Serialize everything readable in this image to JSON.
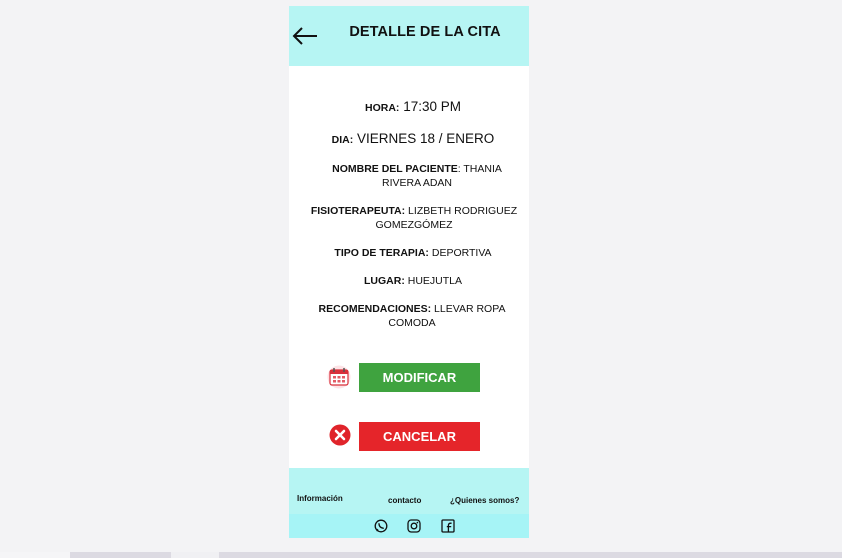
{
  "header": {
    "title": "DETALLE DE LA CITA",
    "back_icon": "arrow-left-icon",
    "background": "#b6f5f3"
  },
  "details": {
    "hora": {
      "label": "HORA:",
      "value": " 17:30 PM"
    },
    "dia": {
      "label": "DIA:",
      "value": " VIERNES 18 / ENERO"
    },
    "paciente": {
      "label": "NOMBRE DEL PACIENTE",
      "value": ": THANIA RIVERA ADAN"
    },
    "fisioterapeuta": {
      "label": "FISIOTERAPEUTA:",
      "value": " LIZBETH RODRIGUEZ GOMEZGÓMEZ"
    },
    "terapia": {
      "label": "TIPO DE TERAPIA:",
      "value": " DEPORTIVA"
    },
    "lugar": {
      "label": "LUGAR:",
      "value": " HUEJUTLA"
    },
    "recomendaciones": {
      "label": "RECOMENDACIONES:",
      "value": " LLEVAR ROPA COMODA"
    }
  },
  "actions": {
    "modify_label": "MODIFICAR",
    "modify_color": "#3fa33f",
    "modify_icon": "calendar-icon",
    "cancel_label": "CANCELAR",
    "cancel_color": "#e5252a",
    "cancel_icon": "close-circle-icon"
  },
  "footer": {
    "links": [
      "Información",
      "contacto",
      "¿Quienes somos?"
    ],
    "social_icons": [
      "whatsapp-icon",
      "instagram-icon",
      "facebook-icon"
    ]
  }
}
